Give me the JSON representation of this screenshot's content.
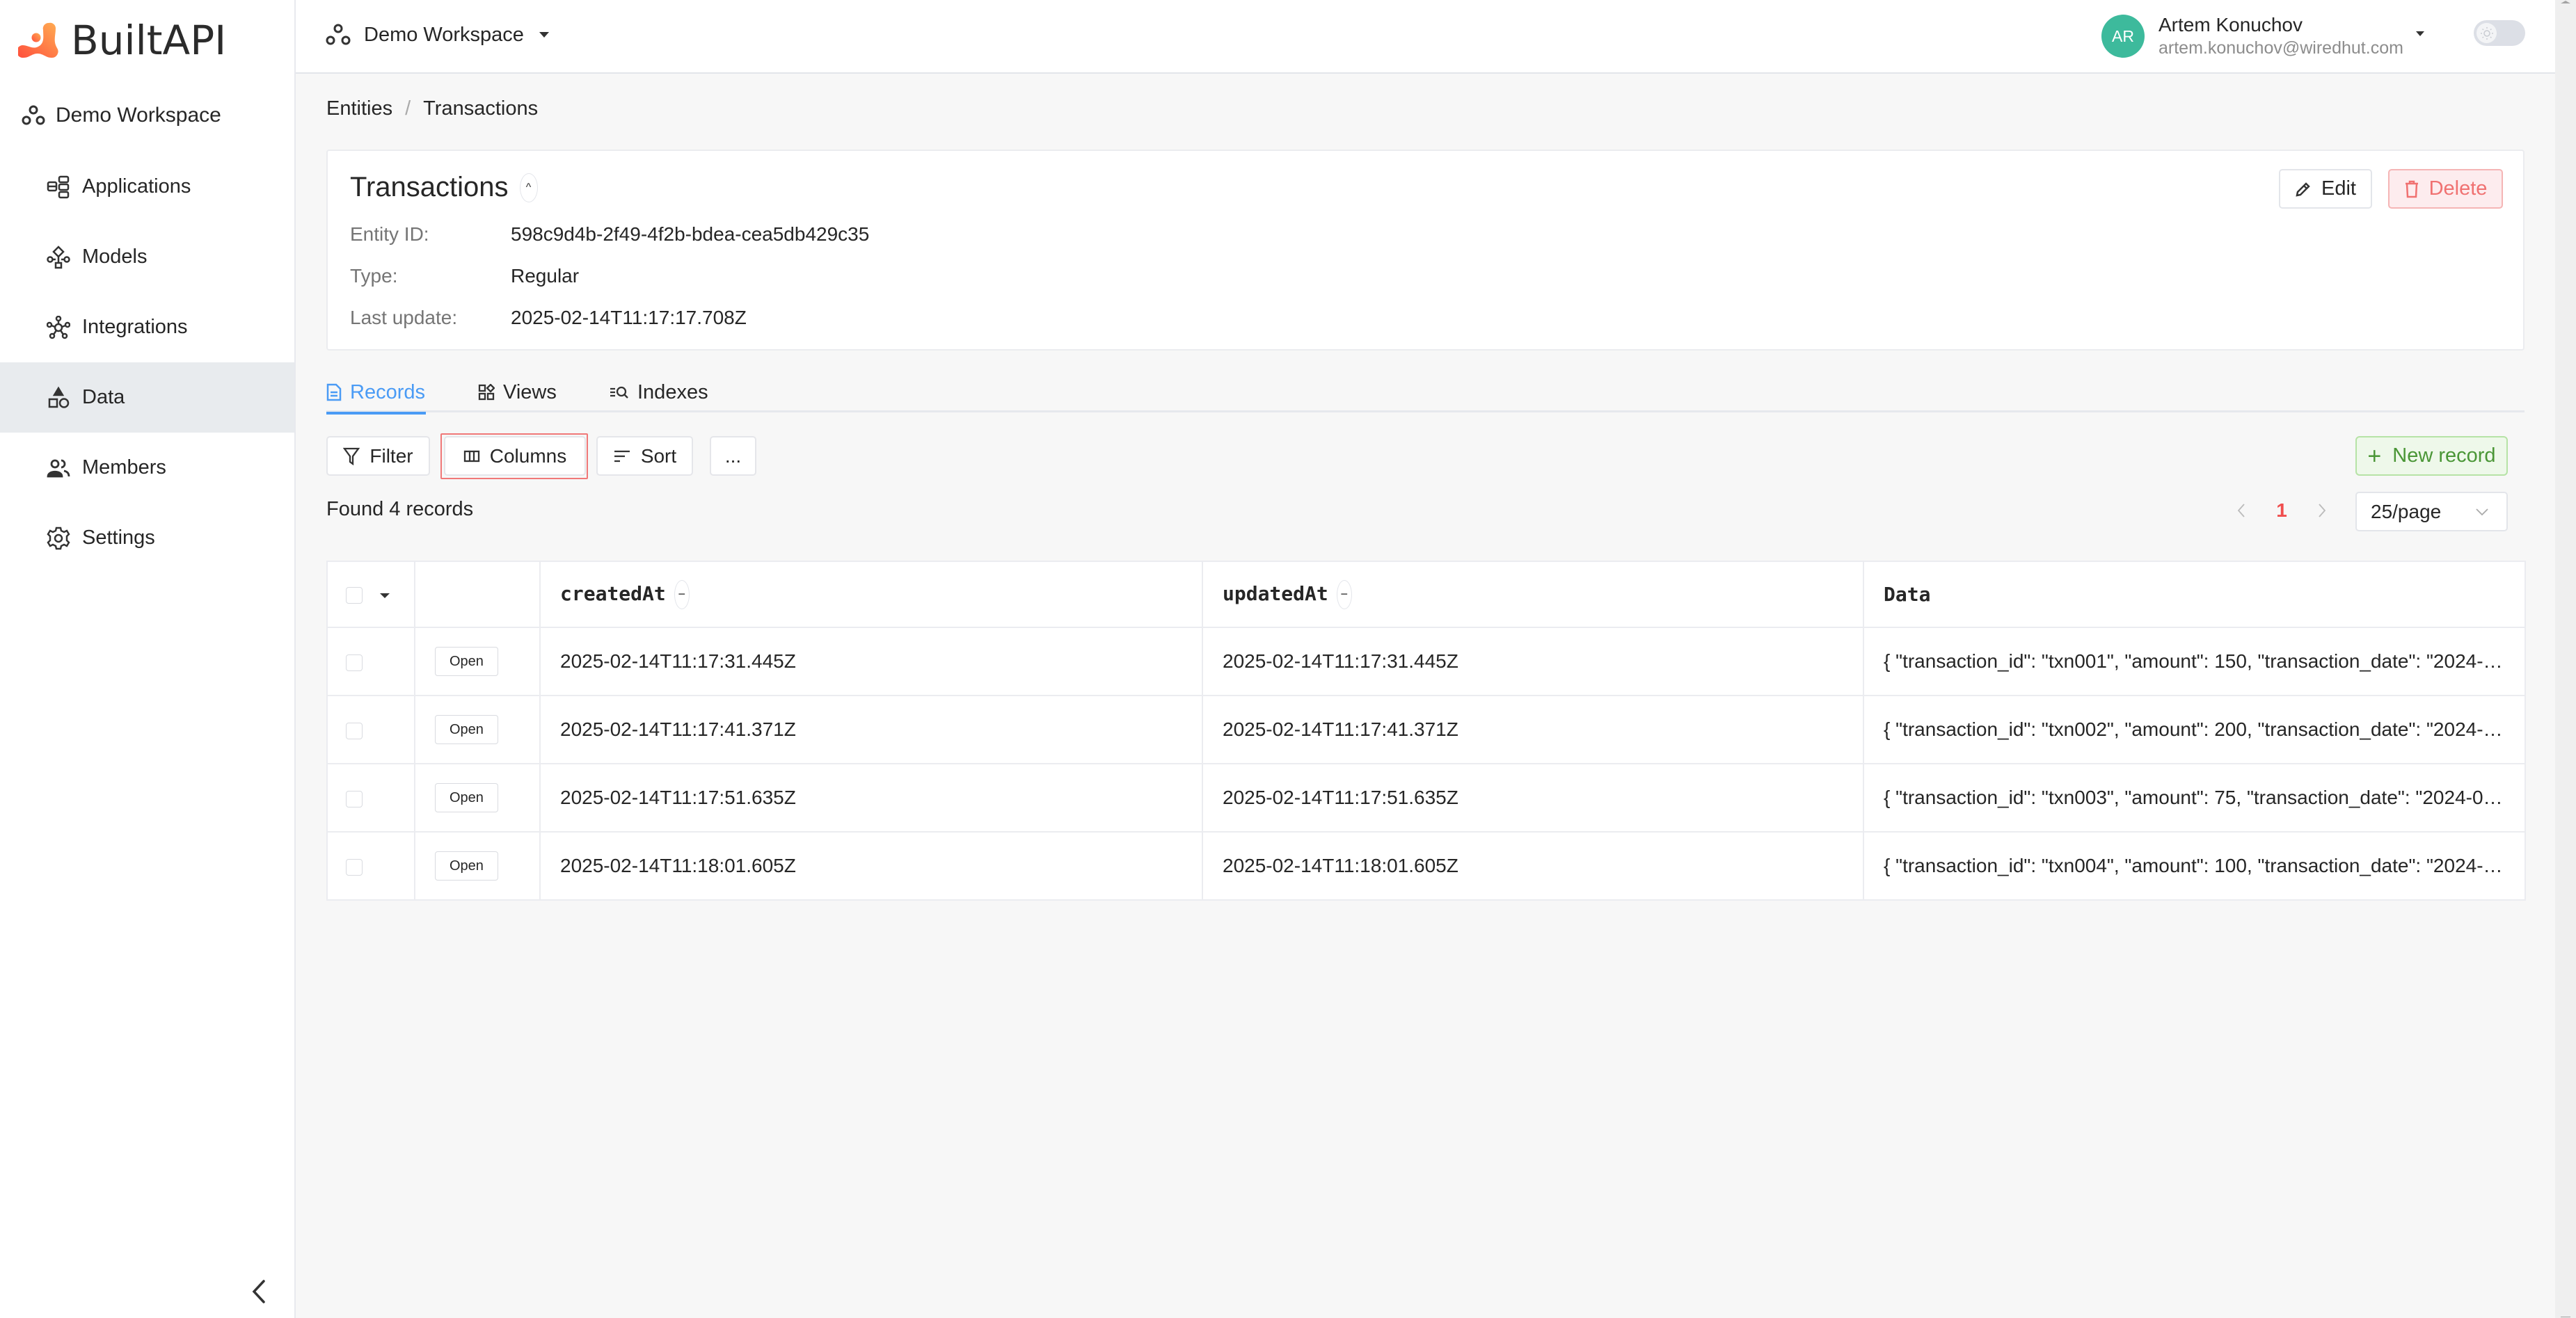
{
  "brand": {
    "name": "BuiltAPI"
  },
  "sidebar": {
    "workspace": "Demo Workspace",
    "items": [
      {
        "label": "Applications",
        "icon": "applications-icon",
        "active": false
      },
      {
        "label": "Models",
        "icon": "models-icon",
        "active": false
      },
      {
        "label": "Integrations",
        "icon": "integrations-icon",
        "active": false
      },
      {
        "label": "Data",
        "icon": "data-icon",
        "active": true
      },
      {
        "label": "Members",
        "icon": "members-icon",
        "active": false
      },
      {
        "label": "Settings",
        "icon": "gear-icon",
        "active": false
      }
    ],
    "collapse_icon": "chevron-left-icon"
  },
  "topbar": {
    "workspace": "Demo Workspace",
    "user": {
      "initials": "AR",
      "name": "Artem Konuchov",
      "email": "artem.konuchov@wiredhut.com",
      "avatar_color": "#3dba9c"
    },
    "theme_toggle": {
      "state": "light",
      "icon": "sun-icon"
    }
  },
  "breadcrumb": [
    "Entities",
    "Transactions"
  ],
  "entity": {
    "title": "Transactions",
    "collapse_symbol": "^",
    "fields": [
      {
        "label": "Entity ID:",
        "value": "598c9d4b-2f49-4f2b-bdea-cea5db429c35"
      },
      {
        "label": "Type:",
        "value": "Regular"
      },
      {
        "label": "Last update:",
        "value": "2025-02-14T11:17:17.708Z"
      }
    ],
    "edit_label": "Edit",
    "delete_label": "Delete"
  },
  "tabs": [
    {
      "label": "Records",
      "icon": "document-icon",
      "active": true
    },
    {
      "label": "Views",
      "icon": "views-icon",
      "active": false
    },
    {
      "label": "Indexes",
      "icon": "index-search-icon",
      "active": false
    }
  ],
  "toolbar": {
    "filter_label": "Filter",
    "columns_label": "Columns",
    "sort_label": "Sort",
    "more_label": "...",
    "new_record_label": "New record",
    "new_record_symbol": "+"
  },
  "records": {
    "found_text": "Found 4 records",
    "pagination": {
      "prev": "<",
      "current": "1",
      "next": ">",
      "page_size": "25/page"
    },
    "columns": [
      {
        "key": "createdAt",
        "label": "createdAt",
        "toggle": "−"
      },
      {
        "key": "updatedAt",
        "label": "updatedAt",
        "toggle": "−"
      },
      {
        "key": "data",
        "label": "Data"
      }
    ],
    "open_label": "Open",
    "rows": [
      {
        "createdAt": "2025-02-14T11:17:31.445Z",
        "updatedAt": "2025-02-14T11:17:31.445Z",
        "data": "{ \"transaction_id\": \"txn001\", \"amount\": 150, \"transaction_date\": \"2024-…"
      },
      {
        "createdAt": "2025-02-14T11:17:41.371Z",
        "updatedAt": "2025-02-14T11:17:41.371Z",
        "data": "{ \"transaction_id\": \"txn002\", \"amount\": 200, \"transaction_date\": \"2024-…"
      },
      {
        "createdAt": "2025-02-14T11:17:51.635Z",
        "updatedAt": "2025-02-14T11:17:51.635Z",
        "data": "{ \"transaction_id\": \"txn003\", \"amount\": 75, \"transaction_date\": \"2024-0…"
      },
      {
        "createdAt": "2025-02-14T11:18:01.605Z",
        "updatedAt": "2025-02-14T11:18:01.605Z",
        "data": "{ \"transaction_id\": \"txn004\", \"amount\": 100, \"transaction_date\": \"2024-…"
      }
    ]
  },
  "colors": {
    "accent_blue": "#4a9bf5",
    "danger": "#f07171",
    "success": "#4a9636",
    "active_page": "#f04e4e",
    "focus_ring": "#f07878"
  }
}
